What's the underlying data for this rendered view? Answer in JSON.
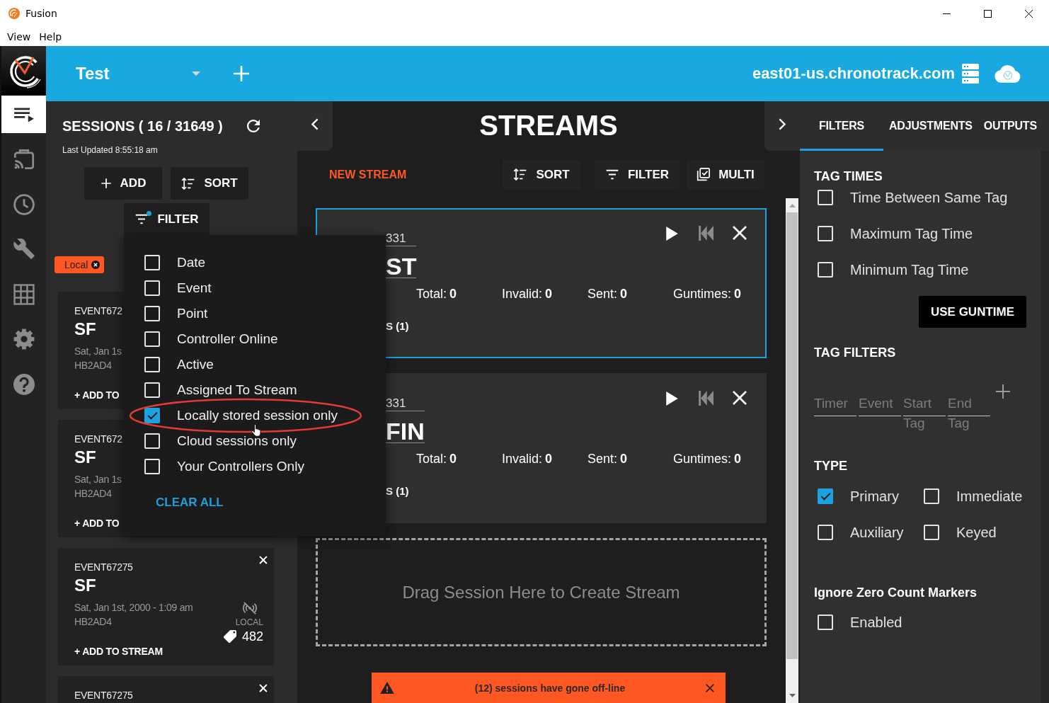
{
  "window": {
    "title": "Fusion",
    "menu": [
      "View",
      "Help"
    ]
  },
  "header": {
    "event": "Test",
    "server": "east01-us.chronotrack.com"
  },
  "nav_rail": {
    "items": [
      {
        "kind": "list",
        "selected": true
      },
      {
        "kind": "cast",
        "selected": false
      },
      {
        "kind": "clock",
        "selected": false
      },
      {
        "kind": "wrench",
        "selected": false
      },
      {
        "kind": "grid",
        "selected": false
      },
      {
        "kind": "gear",
        "selected": false
      },
      {
        "kind": "help",
        "selected": false
      }
    ]
  },
  "sessions": {
    "title": "SESSIONS ( 16 / 31649 )",
    "last_updated": "Last Updated 8:55:18 am",
    "buttons": [
      {
        "kind": "add",
        "label": "ADD"
      },
      {
        "kind": "sort",
        "label": "SORT"
      },
      {
        "kind": "filter",
        "label": "FILTER",
        "active": true
      }
    ],
    "chips": [
      {
        "label": "Local"
      }
    ],
    "cards": [
      {
        "event": "EVENT672",
        "name": "SF",
        "date": "Sat, Jan 1s",
        "device": "HB2AD4",
        "action": "+ ADD TO"
      },
      {
        "event": "EVENT672",
        "name": "SF",
        "date": "Sat, Jan 1s",
        "device": "HB2AD4",
        "action": "+ ADD TO"
      },
      {
        "event": "EVENT67275",
        "name": "SF",
        "date": "Sat, Jan 1st, 2000 - 1:09 am",
        "device": "HB2AD4",
        "storage": "LOCAL",
        "tag_count": "482",
        "action": "+ ADD TO STREAM",
        "close": "✕"
      },
      {
        "event": "EVENT67275",
        "close": "✕"
      }
    ]
  },
  "filter_menu": {
    "options": [
      {
        "label": "Date",
        "checked": false,
        "highlighted": false
      },
      {
        "label": "Event",
        "checked": false,
        "highlighted": false
      },
      {
        "label": "Point",
        "checked": false,
        "highlighted": false
      },
      {
        "label": "Controller Online",
        "checked": false,
        "highlighted": false
      },
      {
        "label": "Active",
        "checked": false,
        "highlighted": false
      },
      {
        "label": "Assigned To Stream",
        "checked": false,
        "highlighted": false
      },
      {
        "label": "Locally stored session only",
        "checked": true,
        "highlighted": true
      },
      {
        "label": "Cloud sessions only",
        "checked": false,
        "highlighted": false
      },
      {
        "label": "Your Controllers Only",
        "checked": false,
        "highlighted": false
      }
    ],
    "clear": "CLEAR ALL"
  },
  "streams": {
    "title": "STREAMS",
    "new_stream": "NEW STREAM",
    "toolbar": [
      {
        "kind": "sort",
        "label": "SORT"
      },
      {
        "kind": "filter",
        "label": "FILTER",
        "active": false
      },
      {
        "kind": "multi",
        "label": "MULTI"
      }
    ],
    "cards": [
      {
        "event": "331",
        "name": "ST",
        "selected": true,
        "stats": [
          {
            "label": "Total:",
            "value": "0"
          },
          {
            "label": "Invalid:",
            "value": "0"
          },
          {
            "label": "Sent:",
            "value": "0"
          },
          {
            "label": "Guntimes:",
            "value": "0"
          }
        ],
        "sessions": "S (1)"
      },
      {
        "event": "331",
        "name": "FIN",
        "selected": false,
        "stats": [
          {
            "label": "Total:",
            "value": "0"
          },
          {
            "label": "Invalid:",
            "value": "0"
          },
          {
            "label": "Sent:",
            "value": "0"
          },
          {
            "label": "Guntimes:",
            "value": "0"
          }
        ],
        "sessions": "S (1)"
      }
    ],
    "drop_zone": "Drag Session Here to Create Stream"
  },
  "toast": {
    "message": "(12) sessions have gone off-line"
  },
  "right_panel": {
    "tabs": [
      {
        "label": "FILTERS",
        "selected": true
      },
      {
        "label": "ADJUSTMENTS",
        "selected": false
      },
      {
        "label": "OUTPUTS",
        "selected": false
      }
    ],
    "tag_times": {
      "title": "TAG TIMES",
      "options": [
        {
          "label": "Time Between Same Tag",
          "checked": false
        },
        {
          "label": "Maximum Tag Time",
          "checked": false
        },
        {
          "label": "Minimum Tag Time",
          "checked": false
        }
      ],
      "button": "USE GUNTIME"
    },
    "tag_filters": {
      "title": "TAG FILTERS",
      "fields": [
        {
          "placeholder": "Timer"
        },
        {
          "placeholder": "Event"
        },
        {
          "placeholder": "Start Tag"
        },
        {
          "placeholder": "End Tag"
        }
      ]
    },
    "type": {
      "title": "TYPE",
      "options": [
        {
          "label": "Primary",
          "checked": true
        },
        {
          "label": "Immediate",
          "checked": false
        },
        {
          "label": "Auxiliary",
          "checked": false
        },
        {
          "label": "Keyed",
          "checked": false
        }
      ]
    },
    "ignore_zero": {
      "title": "Ignore Zero Count Markers",
      "options": [
        {
          "label": "Enabled",
          "checked": false
        }
      ]
    }
  }
}
